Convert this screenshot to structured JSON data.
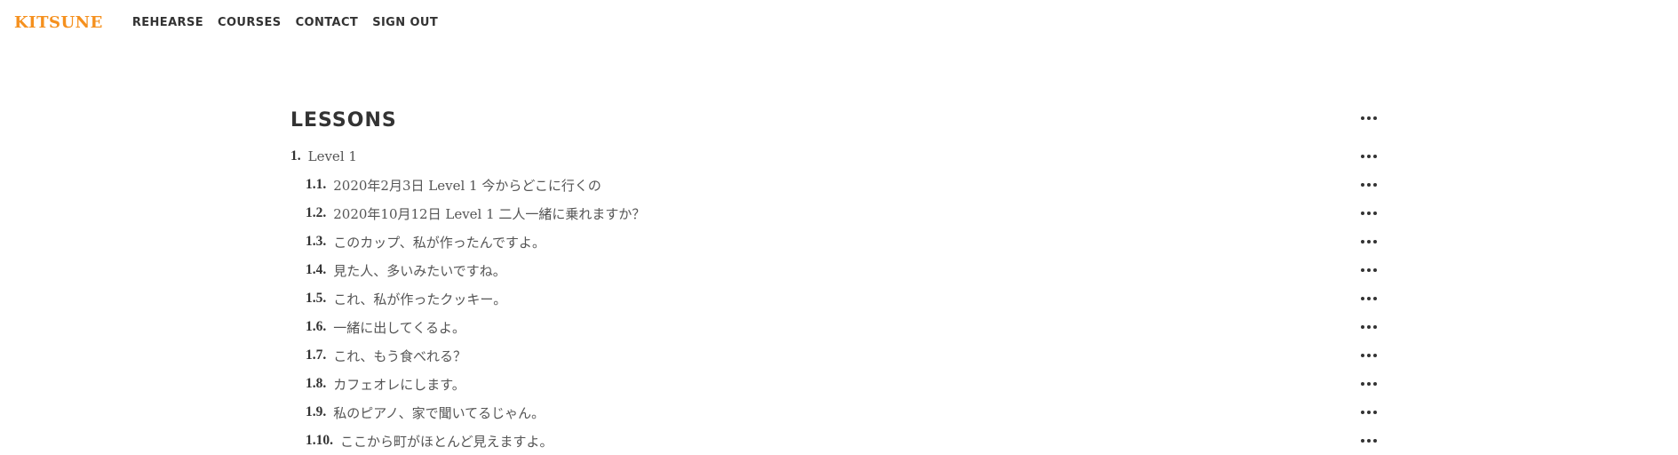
{
  "brand": {
    "logo": "KITSUNE",
    "color": "#f5901e"
  },
  "nav": {
    "links": [
      "REHEARSE",
      "COURSES",
      "CONTACT",
      "SIGN OUT"
    ]
  },
  "section": {
    "title": "LESSONS",
    "more_icon": "more-horizontal-icon"
  },
  "level": {
    "number": "1.",
    "label": "Level 1"
  },
  "lessons": [
    {
      "number": "1.1.",
      "label": "2020年2月3日 Level 1 今からどこに行くの"
    },
    {
      "number": "1.2.",
      "label": "2020年10月12日 Level 1 二人一緒に乗れますか？"
    },
    {
      "number": "1.3.",
      "label": "このカップ、私が作ったんですよ。"
    },
    {
      "number": "1.4.",
      "label": "見た人、多いみたいですね。"
    },
    {
      "number": "1.5.",
      "label": "これ、私が作ったクッキー。"
    },
    {
      "number": "1.6.",
      "label": "一緒に出してくるよ。"
    },
    {
      "number": "1.7.",
      "label": "これ、もう食べれる？"
    },
    {
      "number": "1.8.",
      "label": "カフェオレにします。"
    },
    {
      "number": "1.9.",
      "label": "私のピアノ、家で聞いてるじゃん。"
    },
    {
      "number": "1.10.",
      "label": "ここから町がほとんど見えますよ。"
    }
  ]
}
